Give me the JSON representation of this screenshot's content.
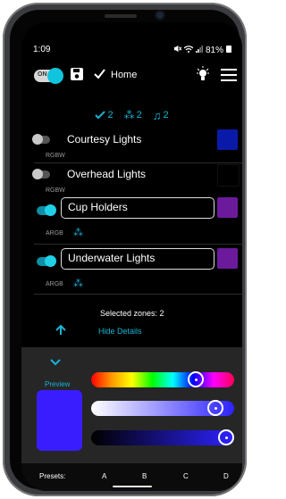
{
  "status_bar": {
    "time": "1:09",
    "battery": "81%"
  },
  "app_bar": {
    "power_label": "ON",
    "title": "Home"
  },
  "counts": {
    "checked": "2",
    "effects": "2",
    "music": "2"
  },
  "zones": [
    {
      "name": "Courtesy Lights",
      "type": "RGBW",
      "enabled": false,
      "color": "#0a1aa8"
    },
    {
      "name": "Overhead Lights",
      "type": "RGBW",
      "enabled": false,
      "color": "#000000"
    },
    {
      "name": "Cup Holders",
      "type": "ARGB",
      "enabled": true,
      "color": "#6b1a9c"
    },
    {
      "name": "Underwater Lights",
      "type": "ARGB",
      "enabled": true,
      "color": "#6b1a9c"
    }
  ],
  "selected_text": "Selected zones: 2",
  "hide_details": "Hide Details",
  "preview_label": "Preview",
  "preview_color": "#3a1dff",
  "sliders": {
    "hue": 0.73,
    "saturation": 0.87,
    "brightness": 0.97
  },
  "presets": {
    "label": "Presets:",
    "items": [
      "A",
      "B",
      "C",
      "D"
    ],
    "selected": "B"
  },
  "colors": {
    "accent": "#17b4d6"
  }
}
